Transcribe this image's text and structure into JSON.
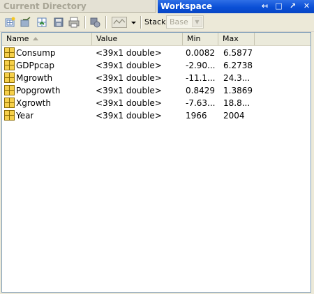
{
  "tabs": {
    "inactive_title": "Current Directory",
    "active_title": "Workspace"
  },
  "window_buttons": {
    "undock": "↤",
    "maximize": "□",
    "restore": "↗",
    "close": "✕"
  },
  "toolbar": {
    "stack_label": "Stack:",
    "stack_value": "Base"
  },
  "table": {
    "columns": [
      "Name",
      "Value",
      "Min",
      "Max"
    ],
    "rows": [
      {
        "name": "Consump",
        "value": "<39x1 double>",
        "min": "0.0082",
        "max": "6.5877"
      },
      {
        "name": "GDPpcap",
        "value": "<39x1 double>",
        "min": "-2.90...",
        "max": "6.2738"
      },
      {
        "name": "Mgrowth",
        "value": "<39x1 double>",
        "min": "-11.1...",
        "max": "24.3..."
      },
      {
        "name": "Popgrowth",
        "value": "<39x1 double>",
        "min": "0.8429",
        "max": "1.3869"
      },
      {
        "name": "Xgrowth",
        "value": "<39x1 double>",
        "min": "-7.63...",
        "max": "18.8..."
      },
      {
        "name": "Year",
        "value": "<39x1 double>",
        "min": "1966",
        "max": "2004"
      }
    ]
  }
}
